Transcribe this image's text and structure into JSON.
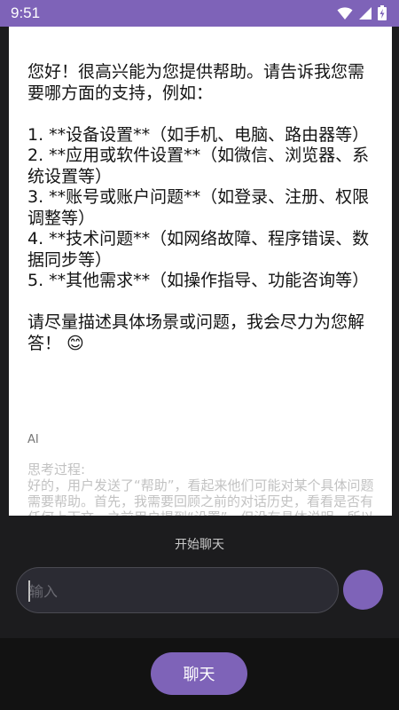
{
  "status": {
    "time": "9:51"
  },
  "message": {
    "reply_lines": [
      "您好！很高兴能为您提供帮助。请告诉我您需要哪方面的支持，例如：",
      "",
      "1. **设备设置**（如手机、电脑、路由器等）",
      "2. **应用或软件设置**（如微信、浏览器、系统设置等）",
      "3. **账号或账户问题**（如登录、注册、权限调整等）",
      "4. **技术问题**（如网络故障、程序错误、数据同步等）",
      "5. **其他需求**（如操作指导、功能咨询等）",
      "",
      "请尽量描述具体场景或问题，我会尽力为您解答！ 😊"
    ],
    "sender": "AI",
    "thinking_title": "思考过程:",
    "thinking_text": "好的，用户发送了“帮助”，看起来他们可能对某个具体问题需要帮助。首先，我需要回顾之前的对话历史，看看是否有任何上下文。之前用户提到“设置”，但没有具体说明，所以我回复请求更多信"
  },
  "composer": {
    "start_chat_label": "开始聊天",
    "input_placeholder": "输入"
  },
  "nav": {
    "chat_button_label": "聊天"
  },
  "colors": {
    "accent": "#7e63b8",
    "panel_bg": "#1c1c1e",
    "card_bg": "#ffffff"
  }
}
